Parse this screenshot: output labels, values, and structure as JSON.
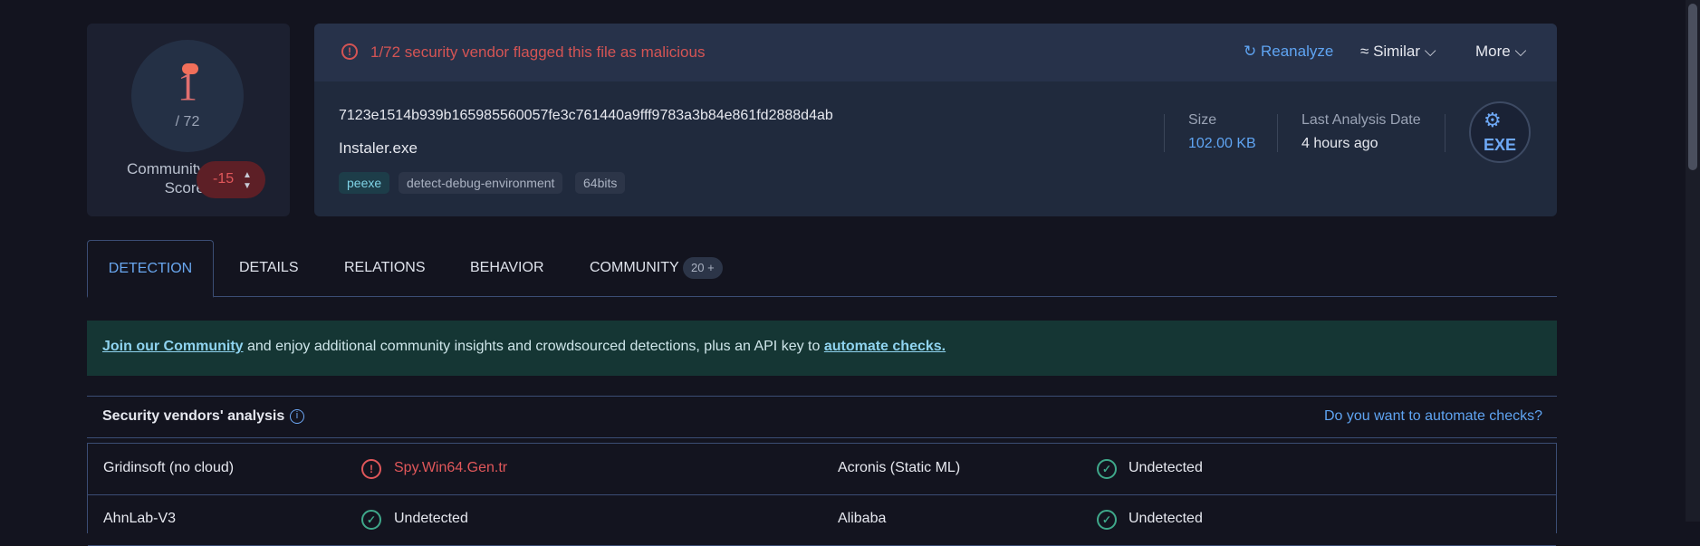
{
  "score": {
    "positives": "1",
    "total": "/ 72",
    "community_label": "Community Score",
    "community_value": "-15"
  },
  "header": {
    "alert": "1/72 security vendor flagged this file as malicious",
    "actions": {
      "reanalyze": "Reanalyze",
      "similar": "Similar",
      "more": "More"
    },
    "hash": "7123e1514b939b165985560057fe3c761440a9fff9783a3b84e861fd2888d4ab",
    "filename": "Instaler.exe",
    "tags": [
      "peexe",
      "detect-debug-environment",
      "64bits"
    ],
    "size_label": "Size",
    "size_value": "102.00 KB",
    "date_label": "Last Analysis Date",
    "date_value": "4 hours ago",
    "file_type": "EXE"
  },
  "tabs": {
    "detection": "DETECTION",
    "details": "DETAILS",
    "relations": "RELATIONS",
    "behavior": "BEHAVIOR",
    "community": "COMMUNITY",
    "community_count": "20 +"
  },
  "banner": {
    "link1": "Join our Community",
    "middle": " and enjoy additional community insights and crowdsourced detections, plus an API key to ",
    "link2": "automate checks."
  },
  "vendors": {
    "title": "Security vendors' analysis",
    "automate": "Do you want to automate checks?",
    "rows": [
      {
        "left": {
          "name": "Gridinsoft (no cloud)",
          "result": "Spy.Win64.Gen.tr",
          "status": "malicious"
        },
        "right": {
          "name": "Acronis (Static ML)",
          "result": "Undetected",
          "status": "undetected"
        }
      },
      {
        "left": {
          "name": "AhnLab-V3",
          "result": "Undetected",
          "status": "undetected"
        },
        "right": {
          "name": "Alibaba",
          "result": "Undetected",
          "status": "undetected"
        }
      }
    ]
  },
  "colors": {
    "accent": "#5fa4f2",
    "malicious": "#e0575a",
    "clean": "#3fa88a"
  }
}
